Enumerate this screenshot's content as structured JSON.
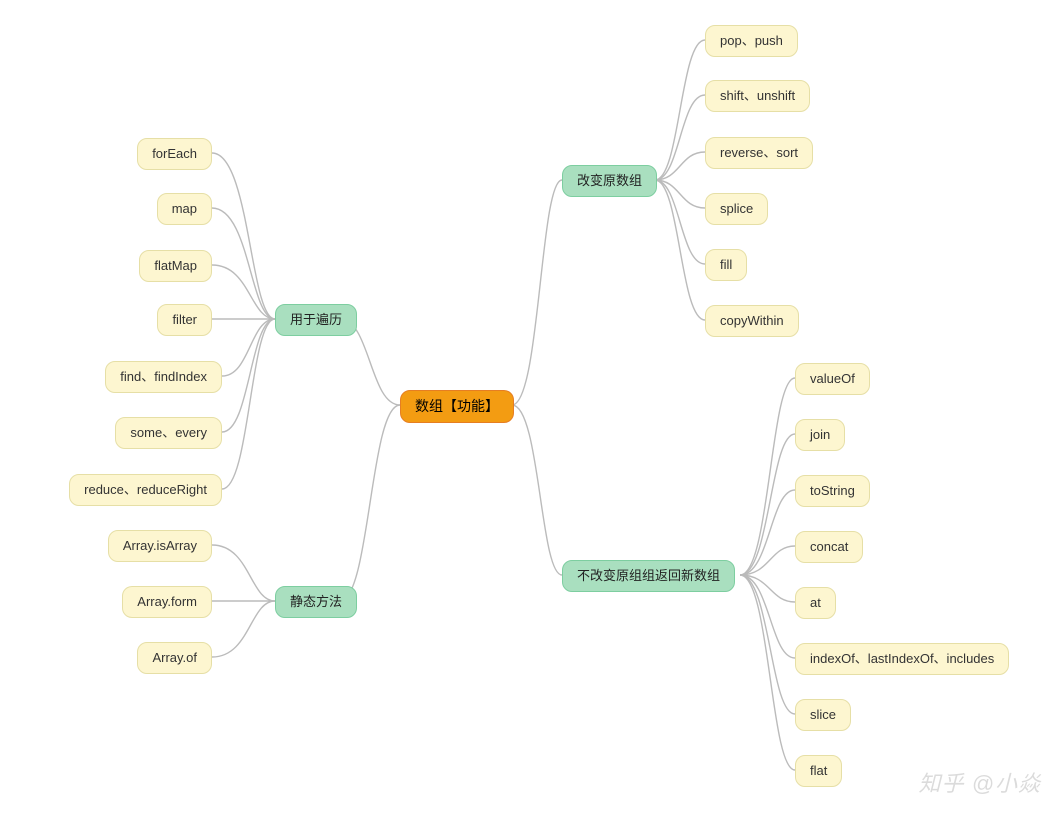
{
  "watermark": "知乎 @小焱",
  "root": {
    "label": "数组【功能】"
  },
  "left_branches": [
    {
      "key": "traversal",
      "label": "用于遍历",
      "children": [
        {
          "label": "forEach"
        },
        {
          "label": "map"
        },
        {
          "label": "flatMap"
        },
        {
          "label": "filter"
        },
        {
          "label": "find、findIndex"
        },
        {
          "label": "some、every"
        },
        {
          "label": "reduce、reduceRight"
        }
      ]
    },
    {
      "key": "static",
      "label": "静态方法",
      "children": [
        {
          "label": "Array.isArray"
        },
        {
          "label": "Array.form"
        },
        {
          "label": "Array.of"
        }
      ]
    }
  ],
  "right_branches": [
    {
      "key": "mutate",
      "label": "改变原数组",
      "children": [
        {
          "label": "pop、push"
        },
        {
          "label": "shift、unshift"
        },
        {
          "label": "reverse、sort"
        },
        {
          "label": "splice"
        },
        {
          "label": "fill"
        },
        {
          "label": "copyWithin"
        }
      ]
    },
    {
      "key": "pure",
      "label": "不改变原组组返回新数组",
      "children": [
        {
          "label": "valueOf"
        },
        {
          "label": "join"
        },
        {
          "label": "toString"
        },
        {
          "label": "concat"
        },
        {
          "label": "at"
        },
        {
          "label": "indexOf、lastIndexOf、includes"
        },
        {
          "label": "slice"
        },
        {
          "label": "flat"
        }
      ]
    }
  ]
}
